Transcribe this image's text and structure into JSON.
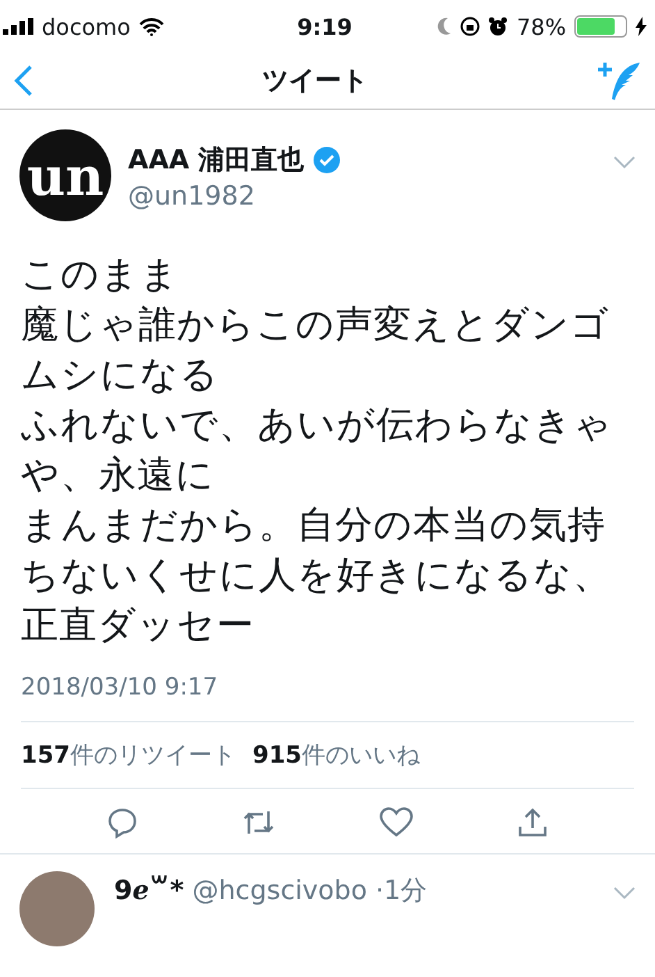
{
  "status_bar": {
    "carrier": "docomo",
    "time": "9:19",
    "battery": "78%"
  },
  "nav": {
    "title": "ツイート"
  },
  "tweet": {
    "name": "AAA 浦田直也",
    "verified": true,
    "handle": "@un1982",
    "avatar_text": "un",
    "text_lines": [
      "このまま",
      "魔じゃ誰からこの声変えとダンゴムシになる",
      "ふれないで、あいが伝わらなきゃや、永遠に",
      "まんまだから。自分の本当の気持ちないくせに人を好きになるな、",
      "正直ダッセー"
    ],
    "timestamp": "2018/03/10 9:17",
    "stats": [
      "**157**件のリツイート",
      "**915**件のいいね"
    ]
  },
  "reply": {
    "name": "9ℯ꒳*",
    "handle": "@hcgscivobo",
    "time": "·1分"
  }
}
